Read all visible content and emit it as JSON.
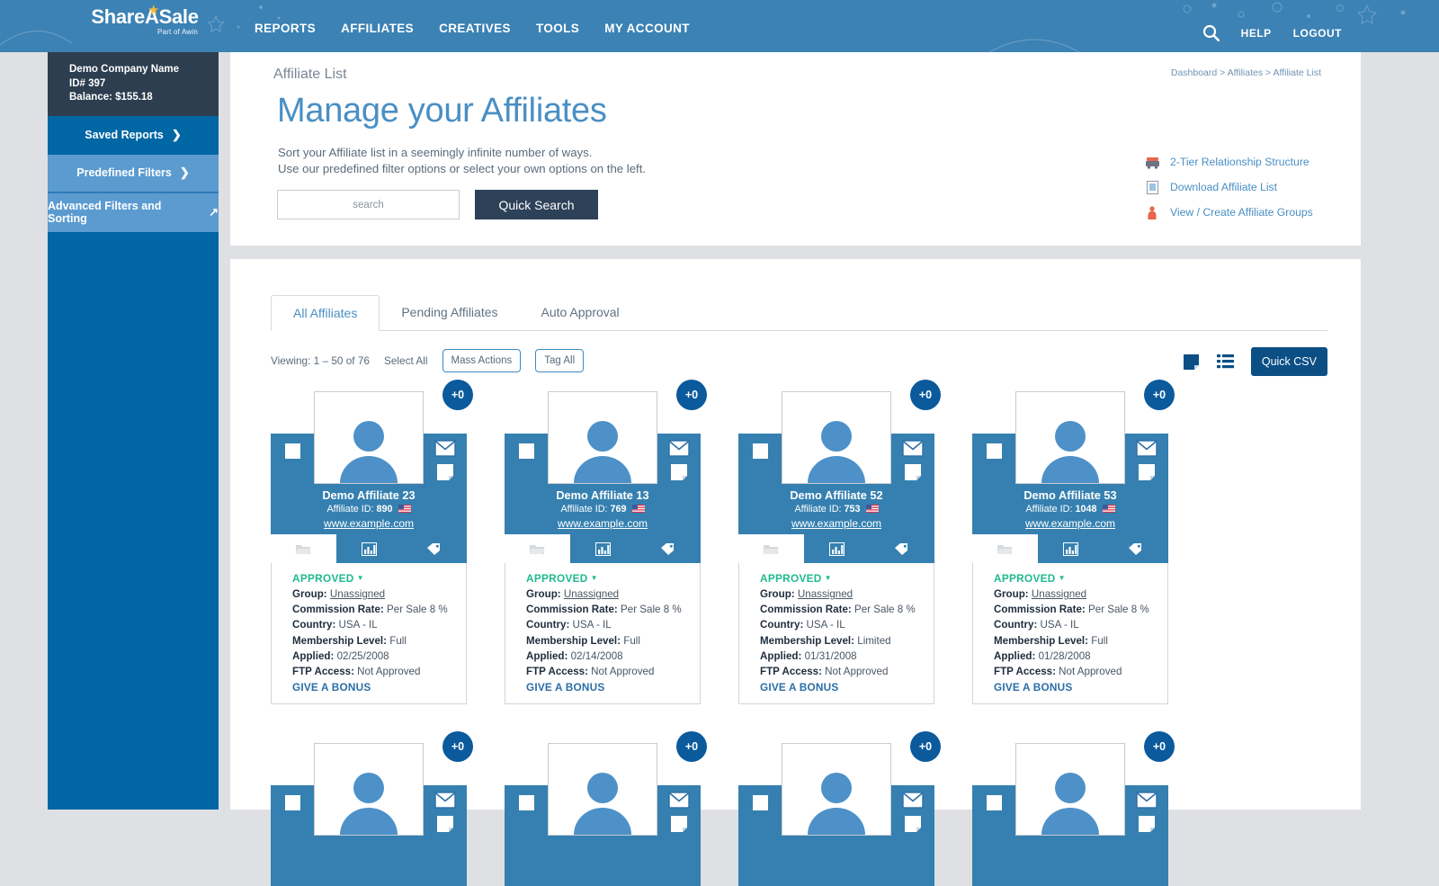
{
  "nav": {
    "logo_text": "ShareASale",
    "logo_sub": "Part of Awin",
    "links": [
      "REPORTS",
      "AFFILIATES",
      "CREATIVES",
      "TOOLS",
      "MY ACCOUNT"
    ],
    "search_icon": "search-icon",
    "help": "HELP",
    "logout": "LOGOUT"
  },
  "sidebar": {
    "company": "Demo Company Name",
    "id": "ID# 397",
    "balance": "Balance: $155.18",
    "saved_reports": "Saved Reports",
    "predefined_filters": "Predefined Filters",
    "advanced_filters": "Advanced Filters and Sorting",
    "chevron": "❯",
    "expand_icon": "↗"
  },
  "hero": {
    "crumb_label": "Affiliate List",
    "breadcrumb": "Dashboard > Affiliates > Affiliate List",
    "title": "Manage your Affiliates",
    "sub_line1": "Sort your Affiliate list in a seemingly infinite number of ways.",
    "sub_line2": "Use our predefined filter options or select your own options on the left.",
    "search_placeholder": "search",
    "search_value": "",
    "quick_search_label": "Quick Search",
    "links": [
      {
        "label": "2-Tier Relationship Structure",
        "icon": "network-icon"
      },
      {
        "label": "Download Affiliate List",
        "icon": "document-icon"
      },
      {
        "label": "View / Create Affiliate Groups",
        "icon": "group-icon"
      }
    ]
  },
  "tabs": [
    {
      "label": "All Affiliates",
      "active": true
    },
    {
      "label": "Pending Affiliates",
      "active": false
    },
    {
      "label": "Auto Approval",
      "active": false
    }
  ],
  "toolbar": {
    "viewing": "Viewing: 1 – 50 of 76",
    "select_all": "Select All",
    "mass_actions": "Mass Actions",
    "tag_all": "Tag All",
    "card_view_icon": "card-view-icon",
    "list_view_icon": "list-view-icon",
    "quick_csv": "Quick CSV"
  },
  "colors": {
    "nav_blue": "#3c82b4",
    "sidebar_blue": "#0066a4",
    "sidebar_light": "#5b9bd0",
    "company_dark": "#2d3e50",
    "card_blue": "#3580b0",
    "badge_blue": "#0a5a9c",
    "accent_link": "#4a8fc4",
    "status_green": "#1fba8e",
    "button_dark": "#2d4159",
    "csv_blue": "#0b4f85",
    "page_bg": "#dfe0e3"
  },
  "card_labels": {
    "group": "Group:",
    "commission": "Commission Rate:",
    "country": "Country:",
    "membership": "Membership Level:",
    "applied": "Applied:",
    "ftp": "FTP Access:",
    "bonus": "GIVE A BONUS",
    "id_prefix": "Affiliate ID:",
    "badge": "+0"
  },
  "affiliates": [
    {
      "name": "Demo Affiliate 23",
      "affiliate_id": "890",
      "url": "www.example.com",
      "badge": "+0",
      "status": "APPROVED",
      "group": "Unassigned",
      "commission_rate": "Per Sale 8 %",
      "country": "USA - IL",
      "membership_level": "Full",
      "applied": "02/25/2008",
      "ftp_access": "Not Approved",
      "bonus": "GIVE A BONUS"
    },
    {
      "name": "Demo Affiliate 13",
      "affiliate_id": "769",
      "url": "www.example.com",
      "badge": "+0",
      "status": "APPROVED",
      "group": "Unassigned",
      "commission_rate": "Per Sale 8 %",
      "country": "USA - IL",
      "membership_level": "Full",
      "applied": "02/14/2008",
      "ftp_access": "Not Approved",
      "bonus": "GIVE A BONUS"
    },
    {
      "name": "Demo Affiliate 52",
      "affiliate_id": "753",
      "url": "www.example.com",
      "badge": "+0",
      "status": "APPROVED",
      "group": "Unassigned",
      "commission_rate": "Per Sale 8 %",
      "country": "USA - IL",
      "membership_level": "Limited",
      "applied": "01/31/2008",
      "ftp_access": "Not Approved",
      "bonus": "GIVE A BONUS"
    },
    {
      "name": "Demo Affiliate 53",
      "affiliate_id": "1048",
      "url": "www.example.com",
      "badge": "+0",
      "status": "APPROVED",
      "group": "Unassigned",
      "commission_rate": "Per Sale 8 %",
      "country": "USA - IL",
      "membership_level": "Full",
      "applied": "01/28/2008",
      "ftp_access": "Not Approved",
      "bonus": "GIVE A BONUS"
    }
  ],
  "second_row_badges": [
    "+0",
    "+0",
    "+0",
    "+0"
  ]
}
